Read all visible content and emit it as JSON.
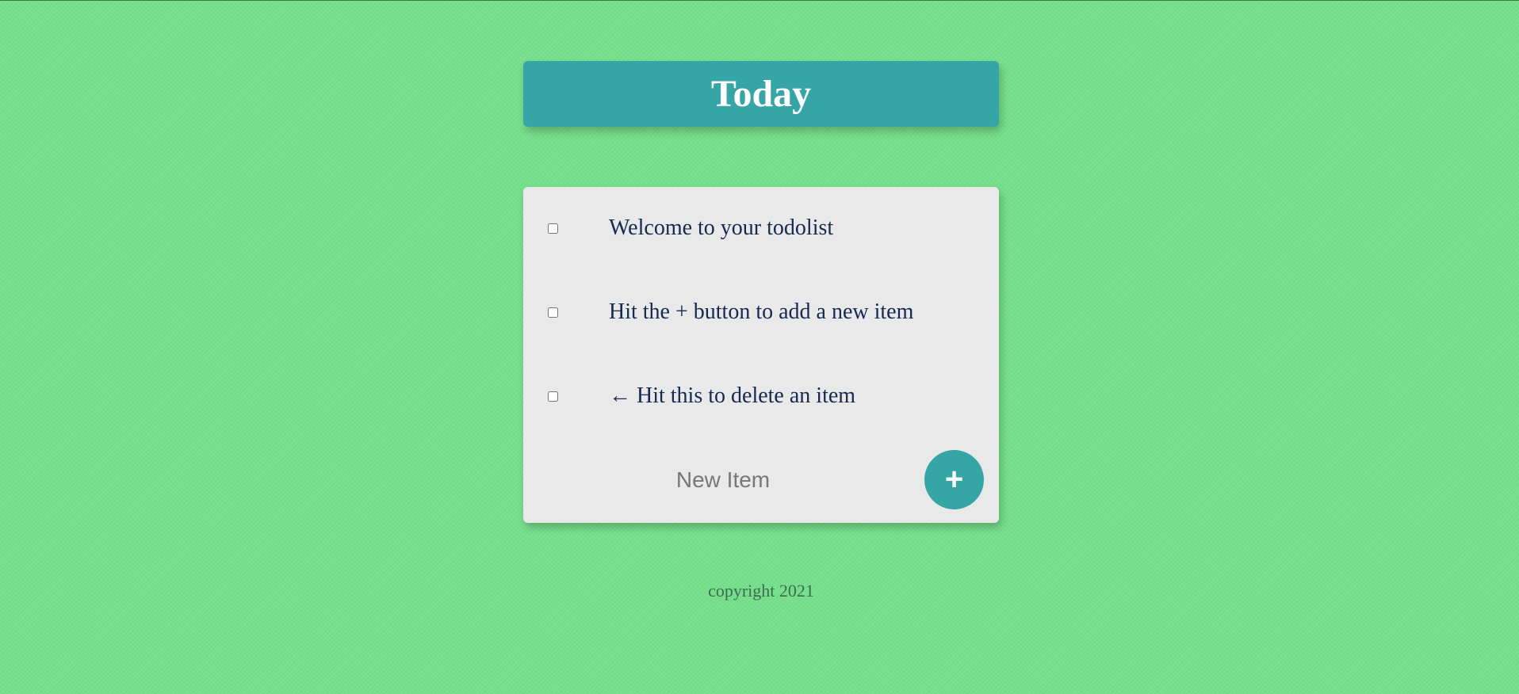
{
  "header": {
    "title": "Today"
  },
  "todo": {
    "items": [
      {
        "label": "Welcome to your todolist",
        "checked": false
      },
      {
        "label": "Hit the + button to add a new item",
        "checked": false
      },
      {
        "label": "← Hit this to delete an item",
        "checked": false
      }
    ],
    "new_item": {
      "placeholder": "New Item",
      "value": ""
    },
    "add_button_label": "+"
  },
  "footer": {
    "text": "copyright 2021"
  },
  "colors": {
    "background": "#76e08c",
    "accent": "#36a5a6",
    "card": "#e9e9e9",
    "item_text": "#16294f"
  }
}
